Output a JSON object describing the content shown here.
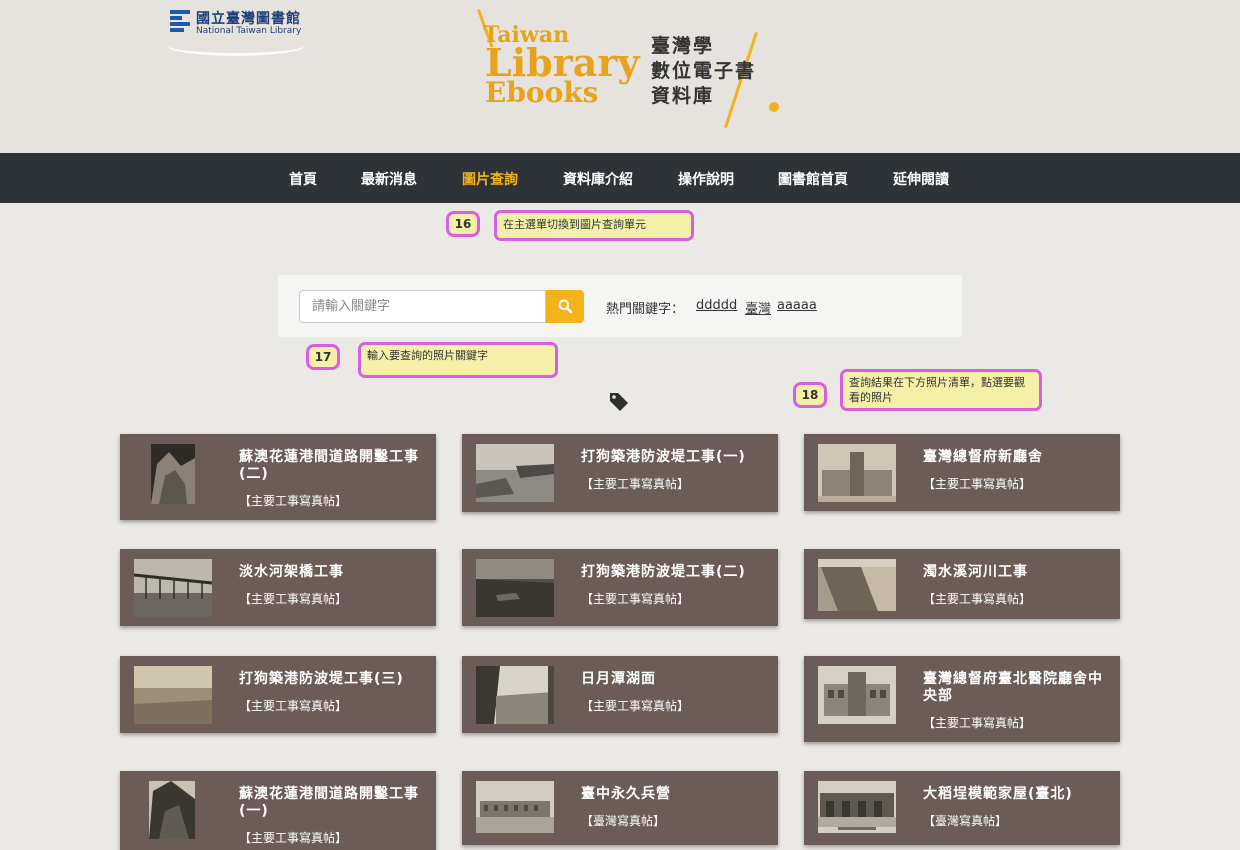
{
  "header": {
    "ntl_logo_zh": "國立臺灣圖書館",
    "ntl_logo_en": "National Taiwan Library",
    "logo_taiwan": "Taiwan",
    "logo_library": "Library",
    "logo_ebooks": "Ebooks",
    "logo_zh_line1": "臺灣學",
    "logo_zh_line2": "數位電子書",
    "logo_zh_line3": "資料庫"
  },
  "nav": {
    "items": [
      {
        "label": "首頁"
      },
      {
        "label": "最新消息"
      },
      {
        "label": "圖片查詢",
        "active": true
      },
      {
        "label": "資料庫介紹"
      },
      {
        "label": "操作說明"
      },
      {
        "label": "圖書館首頁"
      },
      {
        "label": "延伸閱讀"
      }
    ]
  },
  "callouts": [
    {
      "num": "16",
      "text": "在主選單切換到圖片查詢單元"
    },
    {
      "num": "17",
      "text": "輸入要查詢的照片關鍵字"
    },
    {
      "num": "18",
      "text": "查詢結果在下方照片清單，點選要觀看的照片"
    }
  ],
  "search": {
    "placeholder": "請輸入關鍵字",
    "hot_label": "熱門關鍵字：",
    "hot_keywords": [
      "ddddd",
      "臺灣",
      "aaaaa"
    ]
  },
  "colors": {
    "nav_bg": "#2e3338",
    "accent": "#f6b21b",
    "card_bg": "#6b5c58",
    "callout_border": "#d860e0",
    "callout_bg": "#f5f0a8"
  },
  "cards": [
    {
      "title": "蘇澳花蓮港間道路開鑿工事(二)",
      "category": "【主要工事寫真帖】",
      "icon": "cliff-photo"
    },
    {
      "title": "打狗築港防波堤工事(一)",
      "category": "【主要工事寫真帖】",
      "icon": "harbor-photo"
    },
    {
      "title": "臺灣總督府新廳舍",
      "category": "【主要工事寫真帖】",
      "icon": "building-photo"
    },
    {
      "title": "淡水河架橋工事",
      "category": "【主要工事寫真帖】",
      "icon": "bridge-photo"
    },
    {
      "title": "打狗築港防波堤工事(二)",
      "category": "【主要工事寫真帖】",
      "icon": "sea-photo"
    },
    {
      "title": "濁水溪河川工事",
      "category": "【主要工事寫真帖】",
      "icon": "river-photo"
    },
    {
      "title": "打狗築港防波堤工事(三)",
      "category": "【主要工事寫真帖】",
      "icon": "sea-photo"
    },
    {
      "title": "日月潭湖面",
      "category": "【主要工事寫真帖】",
      "icon": "lake-photo"
    },
    {
      "title": "臺灣總督府臺北醫院廳舍中央部",
      "category": "【主要工事寫真帖】",
      "icon": "building-photo"
    },
    {
      "title": "蘇澳花蓮港間道路開鑿工事(一)",
      "category": "【主要工事寫真帖】",
      "icon": "cliff-photo"
    },
    {
      "title": "臺中永久兵營",
      "category": "【臺灣寫真帖】",
      "icon": "barracks-photo"
    },
    {
      "title": "大稻埕模範家屋(臺北)",
      "category": "【臺灣寫真帖】",
      "icon": "street-photo"
    }
  ]
}
